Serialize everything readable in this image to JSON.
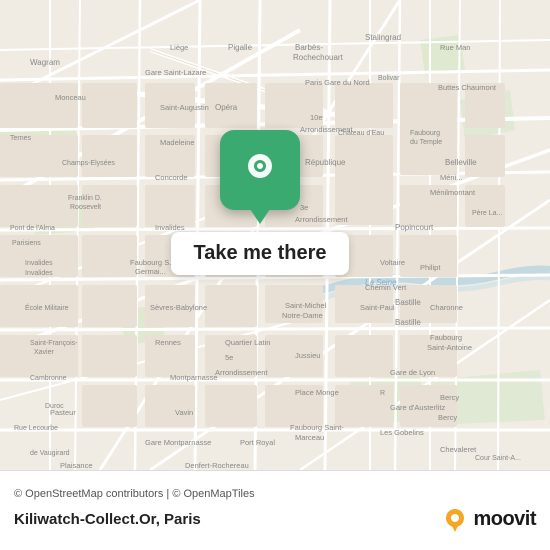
{
  "map": {
    "callout_label": "Take me there",
    "attribution": "© OpenStreetMap contributors | © OpenMapTiles",
    "location_name": "Kiliwatch-Collect.Or, Paris",
    "bg_color": "#f0ece3",
    "road_color": "#ffffff",
    "road_stroke": "#ddd8cc",
    "water_color": "#c8dfe8",
    "green_color": "#c8e6c0",
    "pin_bg": "#3aaa70"
  },
  "moovit": {
    "text": "moovit"
  }
}
